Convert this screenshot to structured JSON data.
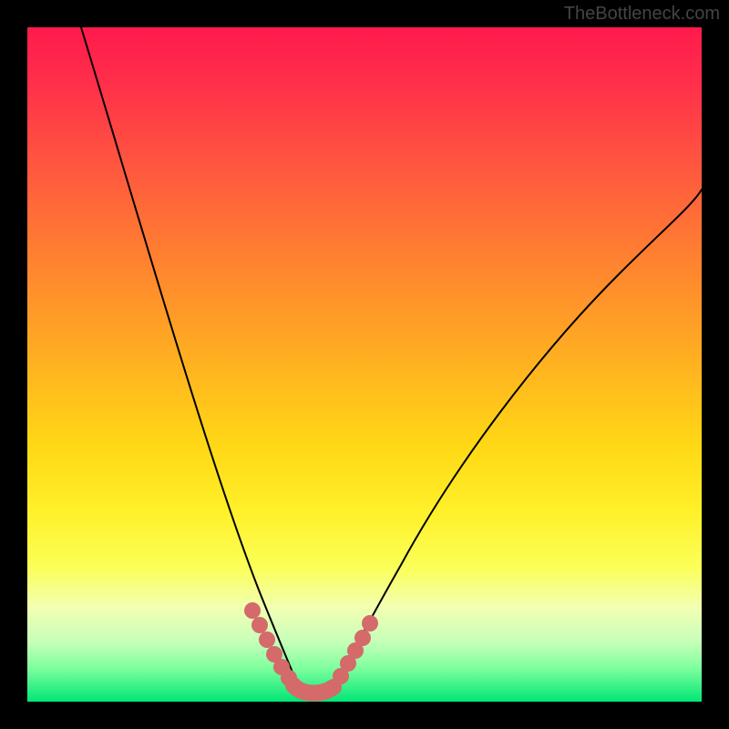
{
  "watermark": {
    "text": "TheBottleneck.com"
  },
  "chart_data": {
    "type": "line",
    "title": "",
    "xlabel": "",
    "ylabel": "",
    "xlim": [
      0,
      100
    ],
    "ylim": [
      0,
      100
    ],
    "grid": false,
    "legend": false,
    "background": "vertical-gradient red→orange→yellow→green",
    "series": [
      {
        "name": "left-branch",
        "x": [
          8,
          12,
          16,
          20,
          24,
          28,
          31,
          34,
          36,
          38,
          39,
          40
        ],
        "values": [
          100,
          86,
          72,
          58,
          45,
          33,
          23,
          14,
          8,
          4,
          2,
          1
        ]
      },
      {
        "name": "right-branch",
        "x": [
          40,
          42,
          44,
          48,
          52,
          58,
          66,
          76,
          88,
          100
        ],
        "values": [
          1,
          2,
          4,
          8,
          14,
          23,
          36,
          50,
          64,
          76
        ]
      },
      {
        "name": "markers-left",
        "marker_only": true,
        "x": [
          31,
          32.5,
          34,
          35.5,
          37,
          38,
          39,
          40
        ],
        "values": [
          12,
          9.5,
          7,
          5,
          3.5,
          2.5,
          1.8,
          1.2
        ]
      },
      {
        "name": "markers-valley",
        "marker_only": true,
        "x": [
          40,
          41,
          42,
          43,
          44
        ],
        "values": [
          1,
          1,
          1,
          1,
          1.2
        ]
      },
      {
        "name": "markers-right",
        "marker_only": true,
        "x": [
          45,
          46,
          47,
          48,
          49,
          50
        ],
        "values": [
          2,
          3,
          4.5,
          6,
          8,
          10
        ]
      }
    ],
    "colors": {
      "curve": "#000000",
      "markers": "#d46a6a"
    }
  }
}
